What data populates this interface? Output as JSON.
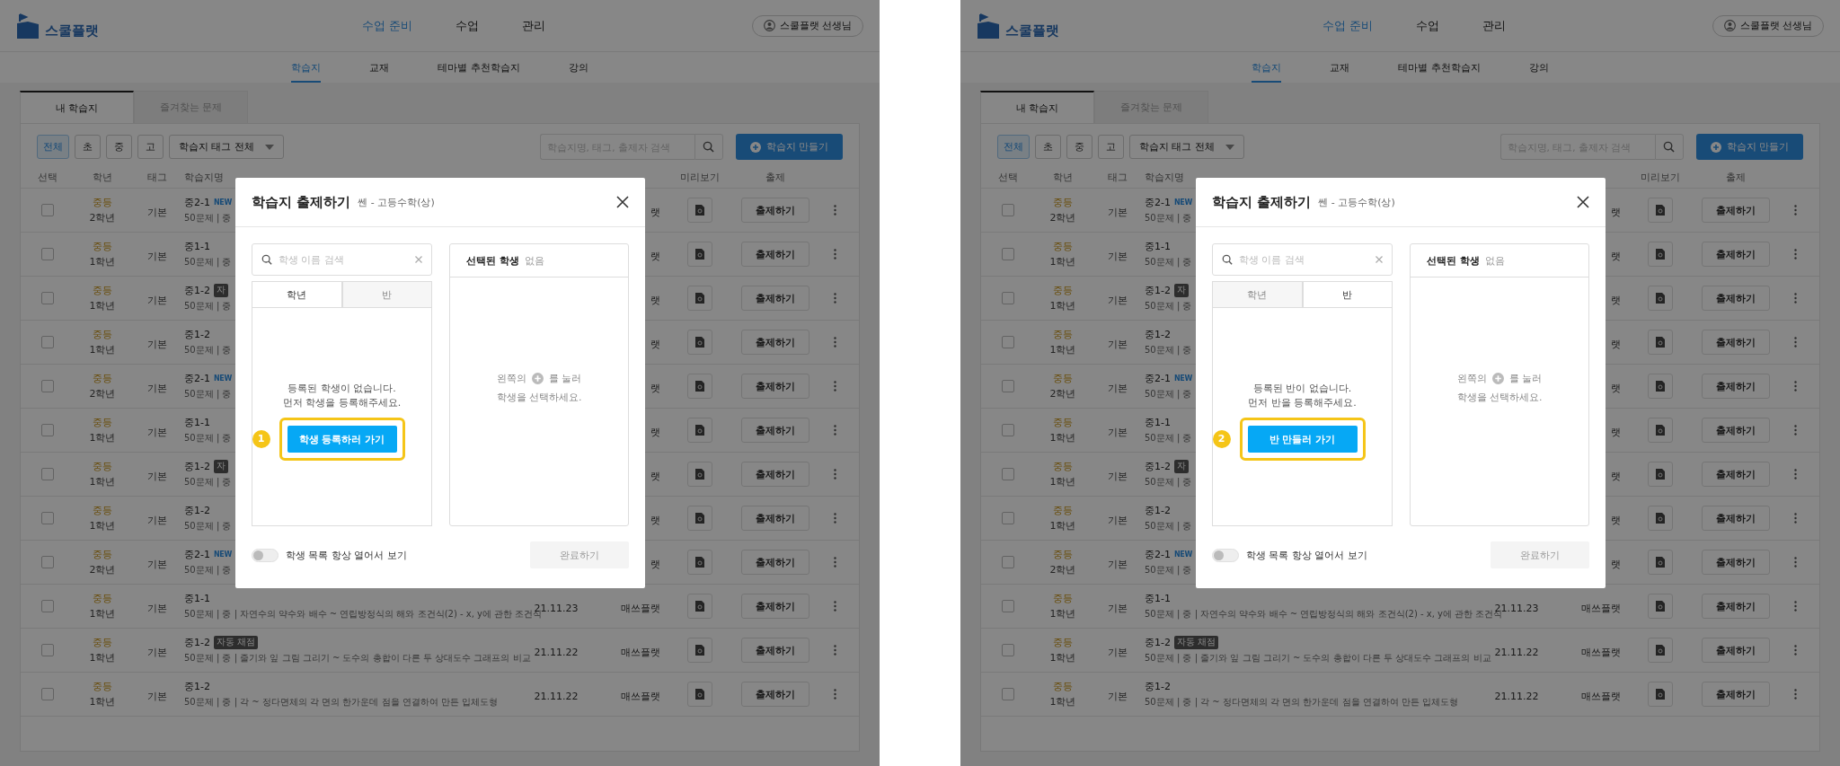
{
  "panels": [
    {
      "header": {
        "logo": "스쿨플랫",
        "nav": [
          {
            "label": "수업 준비",
            "selected": true
          },
          {
            "label": "수업",
            "selected": false
          },
          {
            "label": "관리",
            "selected": false
          }
        ],
        "user": "스쿨플랫 선생님"
      },
      "subnav": [
        {
          "label": "학습지",
          "selected": true
        },
        {
          "label": "교재",
          "selected": false
        },
        {
          "label": "테마별 추천학습지",
          "selected": false
        },
        {
          "label": "강의",
          "selected": false
        }
      ],
      "tabs": [
        {
          "label": "내 학습지",
          "selected": true
        },
        {
          "label": "즐겨찾는 문제",
          "selected": false
        }
      ],
      "filters": [
        {
          "label": "전체",
          "selected": true
        },
        {
          "label": "초",
          "selected": false
        },
        {
          "label": "중",
          "selected": false
        },
        {
          "label": "고",
          "selected": false
        }
      ],
      "tag_select": "학습지 태그 전체",
      "search": {
        "placeholder": "학습지명, 태그, 출제자 검색"
      },
      "create_button": "학습지 만들기",
      "columns": [
        "선택",
        "학년",
        "태그",
        "학습지명",
        "미리보기",
        "출제"
      ],
      "rows": [
        {
          "checked": false,
          "level": "중등",
          "year": "2학년",
          "tag": "기본",
          "title": "중2-1",
          "badge": {
            "kind": "new",
            "text": "NEW"
          },
          "desc": "50문제 | 중",
          "publisher": "랫",
          "action": "출제하기"
        },
        {
          "checked": false,
          "level": "중등",
          "year": "1학년",
          "tag": "기본",
          "title": "중1-1",
          "desc": "50문제 | 중",
          "publisher": "랫",
          "action": "출제하기"
        },
        {
          "checked": false,
          "level": "중등",
          "year": "1학년",
          "tag": "기본",
          "title": "중1-2",
          "badge": {
            "kind": "auto",
            "text": "자"
          },
          "desc": "50문제 | 중",
          "publisher": "랫",
          "action": "출제하기"
        },
        {
          "checked": false,
          "level": "중등",
          "year": "1학년",
          "tag": "기본",
          "title": "중1-2",
          "desc": "50문제 | 중",
          "publisher": "랫",
          "action": "출제하기"
        },
        {
          "checked": false,
          "level": "중등",
          "year": "2학년",
          "tag": "기본",
          "title": "중2-1",
          "badge": {
            "kind": "new",
            "text": "NEW"
          },
          "desc": "50문제 | 중",
          "publisher": "랫",
          "action": "출제하기"
        },
        {
          "checked": false,
          "level": "중등",
          "year": "1학년",
          "tag": "기본",
          "title": "중1-1",
          "desc": "50문제 | 중",
          "publisher": "랫",
          "action": "출제하기"
        },
        {
          "checked": false,
          "level": "중등",
          "year": "1학년",
          "tag": "기본",
          "title": "중1-2",
          "badge": {
            "kind": "auto",
            "text": "자"
          },
          "desc": "50문제 | 중",
          "publisher": "랫",
          "action": "출제하기"
        },
        {
          "checked": false,
          "level": "중등",
          "year": "1학년",
          "tag": "기본",
          "title": "중1-2",
          "desc": "50문제 | 중",
          "publisher": "랫",
          "action": "출제하기"
        },
        {
          "checked": false,
          "level": "중등",
          "year": "2학년",
          "tag": "기본",
          "title": "중2-1",
          "badge": {
            "kind": "new",
            "text": "NEW"
          },
          "desc": "50문제 | 중",
          "publisher": "랫",
          "action": "출제하기"
        },
        {
          "checked": false,
          "level": "중등",
          "year": "1학년",
          "tag": "기본",
          "title": "중1-1",
          "desc": "50문제 | 중 | 자연수의 약수와 배수 ~ 연립방정식의 해와 조건식(2) - x, y에 관한 조건식",
          "date": "21.11.23",
          "publisher": "매쓰플랫",
          "action": "출제하기"
        },
        {
          "checked": false,
          "level": "중등",
          "year": "1학년",
          "tag": "기본",
          "title": "중1-2",
          "badge": {
            "kind": "auto",
            "text": "자동 채점"
          },
          "desc": "50문제 | 중 | 줄기와 잎 그림 그리기 ~ 도수의 총합이 다른 두 상대도수 그래프의 비교",
          "date": "21.11.22",
          "publisher": "매쓰플랫",
          "action": "출제하기"
        },
        {
          "checked": false,
          "level": "중등",
          "year": "1학년",
          "tag": "기본",
          "title": "중1-2",
          "desc": "50문제 | 중 | 각 ~ 정다면체의 각 면의 한가운데 점을 연결하여 만든 입체도형",
          "date": "21.11.22",
          "publisher": "매쓰플랫",
          "action": "출제하기"
        }
      ],
      "modal": {
        "title": "학습지 출제하기",
        "subtitle": "쎈 - 고등수학(상)",
        "search": {
          "placeholder": "학생 이름 검색"
        },
        "tabs": [
          {
            "label": "학년",
            "selected": true
          },
          {
            "label": "반",
            "selected": false
          }
        ],
        "empty_message": "등록된 학생이 없습니다.\n먼저 학생을 등록해주세요.",
        "action_button": "학생 등록하러 가기",
        "callout": "1",
        "selected_label": "선택된 학생",
        "selected_value": "없음",
        "hint_before": "왼쪽의",
        "hint_after": "를 눌러",
        "hint_line2": "학생을 선택하세요.",
        "toggle": {
          "label": "학생 목록 항상 열어서 보기",
          "on": false
        },
        "done_button": {
          "label": "완료하기",
          "disabled": true
        }
      }
    },
    {
      "header": {
        "logo": "스쿨플랫",
        "nav": [
          {
            "label": "수업 준비",
            "selected": true
          },
          {
            "label": "수업",
            "selected": false
          },
          {
            "label": "관리",
            "selected": false
          }
        ],
        "user": "스쿨플랫 선생님"
      },
      "subnav": [
        {
          "label": "학습지",
          "selected": true
        },
        {
          "label": "교재",
          "selected": false
        },
        {
          "label": "테마별 추천학습지",
          "selected": false
        },
        {
          "label": "강의",
          "selected": false
        }
      ],
      "tabs": [
        {
          "label": "내 학습지",
          "selected": true
        },
        {
          "label": "즐겨찾는 문제",
          "selected": false
        }
      ],
      "filters": [
        {
          "label": "전체",
          "selected": true
        },
        {
          "label": "초",
          "selected": false
        },
        {
          "label": "중",
          "selected": false
        },
        {
          "label": "고",
          "selected": false
        }
      ],
      "tag_select": "학습지 태그 전체",
      "search": {
        "placeholder": "학습지명, 태그, 출제자 검색"
      },
      "create_button": "학습지 만들기",
      "columns": [
        "선택",
        "학년",
        "태그",
        "학습지명",
        "미리보기",
        "출제"
      ],
      "rows": [
        {
          "checked": false,
          "level": "중등",
          "year": "2학년",
          "tag": "기본",
          "title": "중2-1",
          "badge": {
            "kind": "new",
            "text": "NEW"
          },
          "desc": "50문제 | 중",
          "publisher": "랫",
          "action": "출제하기"
        },
        {
          "checked": false,
          "level": "중등",
          "year": "1학년",
          "tag": "기본",
          "title": "중1-1",
          "desc": "50문제 | 중",
          "publisher": "랫",
          "action": "출제하기"
        },
        {
          "checked": false,
          "level": "중등",
          "year": "1학년",
          "tag": "기본",
          "title": "중1-2",
          "badge": {
            "kind": "auto",
            "text": "자"
          },
          "desc": "50문제 | 중",
          "publisher": "랫",
          "action": "출제하기"
        },
        {
          "checked": false,
          "level": "중등",
          "year": "1학년",
          "tag": "기본",
          "title": "중1-2",
          "desc": "50문제 | 중",
          "publisher": "랫",
          "action": "출제하기"
        },
        {
          "checked": false,
          "level": "중등",
          "year": "2학년",
          "tag": "기본",
          "title": "중2-1",
          "badge": {
            "kind": "new",
            "text": "NEW"
          },
          "desc": "50문제 | 중",
          "publisher": "랫",
          "action": "출제하기"
        },
        {
          "checked": false,
          "level": "중등",
          "year": "1학년",
          "tag": "기본",
          "title": "중1-1",
          "desc": "50문제 | 중",
          "publisher": "랫",
          "action": "출제하기"
        },
        {
          "checked": false,
          "level": "중등",
          "year": "1학년",
          "tag": "기본",
          "title": "중1-2",
          "badge": {
            "kind": "auto",
            "text": "자"
          },
          "desc": "50문제 | 중",
          "publisher": "랫",
          "action": "출제하기"
        },
        {
          "checked": false,
          "level": "중등",
          "year": "1학년",
          "tag": "기본",
          "title": "중1-2",
          "desc": "50문제 | 중",
          "publisher": "랫",
          "action": "출제하기"
        },
        {
          "checked": false,
          "level": "중등",
          "year": "2학년",
          "tag": "기본",
          "title": "중2-1",
          "badge": {
            "kind": "new",
            "text": "NEW"
          },
          "desc": "50문제 | 중",
          "publisher": "랫",
          "action": "출제하기"
        },
        {
          "checked": false,
          "level": "중등",
          "year": "1학년",
          "tag": "기본",
          "title": "중1-1",
          "desc": "50문제 | 중 | 자연수의 약수와 배수 ~ 연립방정식의 해와 조건식(2) - x, y에 관한 조건식",
          "date": "21.11.23",
          "publisher": "매쓰플랫",
          "action": "출제하기"
        },
        {
          "checked": false,
          "level": "중등",
          "year": "1학년",
          "tag": "기본",
          "title": "중1-2",
          "badge": {
            "kind": "auto",
            "text": "자동 채점"
          },
          "desc": "50문제 | 중 | 줄기와 잎 그림 그리기 ~ 도수의 총합이 다른 두 상대도수 그래프의 비교",
          "date": "21.11.22",
          "publisher": "매쓰플랫",
          "action": "출제하기"
        },
        {
          "checked": false,
          "level": "중등",
          "year": "1학년",
          "tag": "기본",
          "title": "중1-2",
          "desc": "50문제 | 중 | 각 ~ 정다면체의 각 면의 한가운데 점을 연결하여 만든 입체도형",
          "date": "21.11.22",
          "publisher": "매쓰플랫",
          "action": "출제하기"
        }
      ],
      "modal": {
        "title": "학습지 출제하기",
        "subtitle": "쎈 - 고등수학(상)",
        "search": {
          "placeholder": "학생 이름 검색"
        },
        "tabs": [
          {
            "label": "학년",
            "selected": false
          },
          {
            "label": "반",
            "selected": true
          }
        ],
        "empty_message": "등록된 반이 없습니다.\n먼저 반을 등록해주세요.",
        "action_button": "반 만들러 가기",
        "callout": "2",
        "selected_label": "선택된 학생",
        "selected_value": "없음",
        "hint_before": "왼쪽의",
        "hint_after": "를 눌러",
        "hint_line2": "학생을 선택하세요.",
        "toggle": {
          "label": "학생 목록 항상 열어서 보기",
          "on": false
        },
        "done_button": {
          "label": "완료하기",
          "disabled": true
        }
      }
    }
  ]
}
